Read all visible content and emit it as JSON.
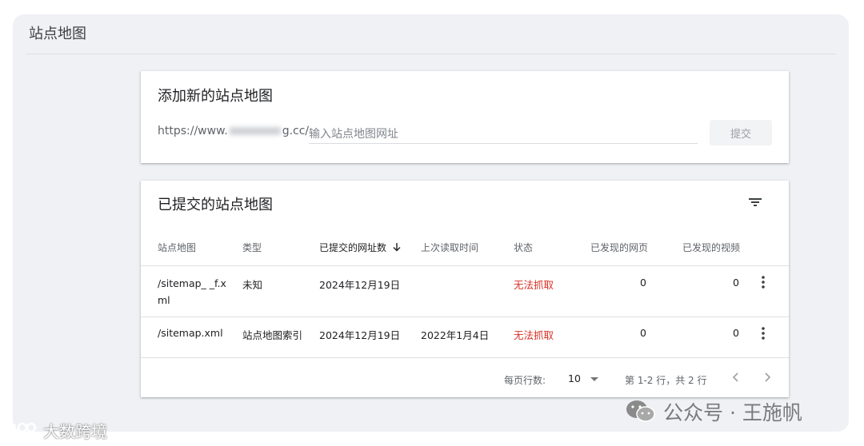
{
  "page": {
    "title": "站点地图"
  },
  "add_card": {
    "title": "添加新的站点地图",
    "url_prefix_start": "https://www.",
    "url_prefix_end": "g.cc/",
    "input_placeholder": "输入站点地图网址",
    "input_value": "",
    "submit_label": "提交"
  },
  "list_card": {
    "title": "已提交的站点地图",
    "filter_icon": "filter-icon",
    "columns": [
      "站点地图",
      "类型",
      "已提交的网址数",
      "上次读取时间",
      "状态",
      "已发现的网页",
      "已发现的视频"
    ],
    "sort_column": "已提交的网址数",
    "sort_direction": "desc",
    "rows": [
      {
        "sitemap": "/sitemap_  _f.xml",
        "type": "未知",
        "submitted": "2024年12月19日",
        "last_read": "",
        "status": "无法抓取",
        "pages": "0",
        "videos": "0"
      },
      {
        "sitemap": "/sitemap.xml",
        "type": "站点地图索引",
        "submitted": "2024年12月19日",
        "last_read": "2022年1月4日",
        "status": "无法抓取",
        "pages": "0",
        "videos": "0"
      }
    ],
    "pagination": {
      "rows_per_page_label": "每页行数:",
      "rows_per_page": "10",
      "range_label": "第 1-2 行，共 2 行"
    }
  },
  "watermarks": {
    "right_text": "公众号 · 王施帆",
    "left_text": "大数跨境"
  },
  "colors": {
    "status_error": "#d93025",
    "background": "#eff1f5",
    "card": "#ffffff"
  }
}
